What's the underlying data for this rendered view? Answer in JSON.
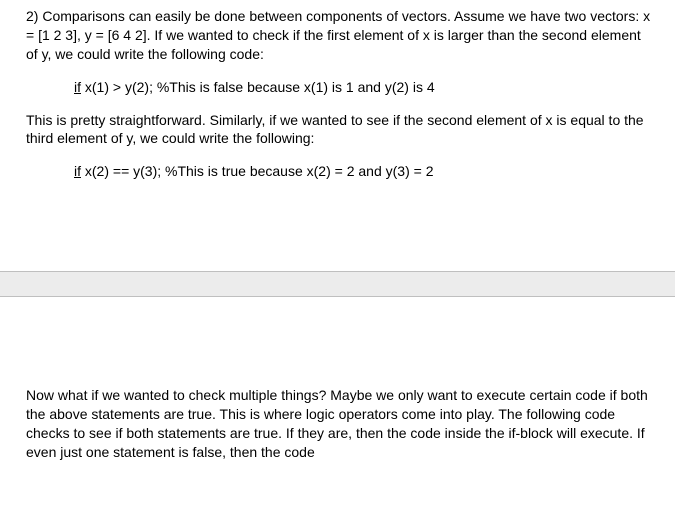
{
  "s1": {
    "p1": "2) Comparisons can easily be done between components of vectors. Assume we have two vectors: x = [1 2 3], y = [6 4 2]. If we wanted to check if the first element of x is larger than the second element of y, we could write the following code:",
    "code1_if": "if",
    "code1_rest": " x(1) > y(2); %This is false because x(1) is 1 and y(2) is 4",
    "p2": "This is pretty straightforward. Similarly, if we wanted to see if the second element of x is equal to the third element of y, we could write the following:",
    "code2_if": "if",
    "code2_rest": " x(2) == y(3); %This is true because x(2) = 2 and y(3) = 2"
  },
  "s2": {
    "p1": "Now what if we wanted to check multiple things? Maybe we only want to execute certain code if both the above statements are true. This is where logic operators come into play. The following code checks to see if both statements are true. If they are, then the code inside the if-block will execute. If even just one statement is false, then the code"
  }
}
